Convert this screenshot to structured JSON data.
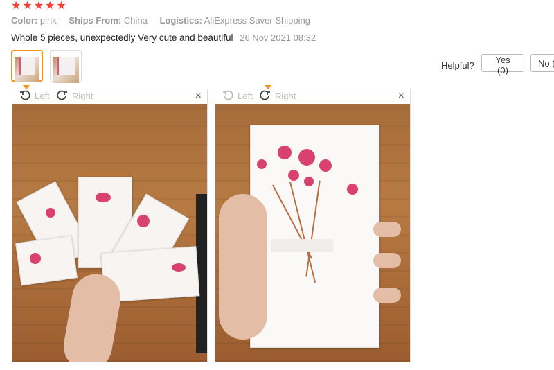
{
  "rating": {
    "stars": 5,
    "star_icon": "star-icon",
    "color": "#f44336"
  },
  "meta": {
    "color_label": "Color:",
    "color_value": "pink",
    "ships_label": "Ships From:",
    "ships_value": "China",
    "logistics_label": "Logistics:",
    "logistics_value": "AliExpress Saver Shipping"
  },
  "review": {
    "text": "Whole 5 pieces, unexpectedly Very cute and beautiful",
    "date": "26 Nov 2021 08:32"
  },
  "helpful": {
    "label": "Helpful?",
    "yes_label": "Yes (0)",
    "no_label": "No ("
  },
  "viewers": [
    {
      "left_label": "Left",
      "right_label": "Right",
      "close_symbol": "×"
    },
    {
      "left_label": "Left",
      "right_label": "Right",
      "close_symbol": "×"
    }
  ],
  "colors": {
    "accent": "#f7931e",
    "muted": "#999999"
  }
}
